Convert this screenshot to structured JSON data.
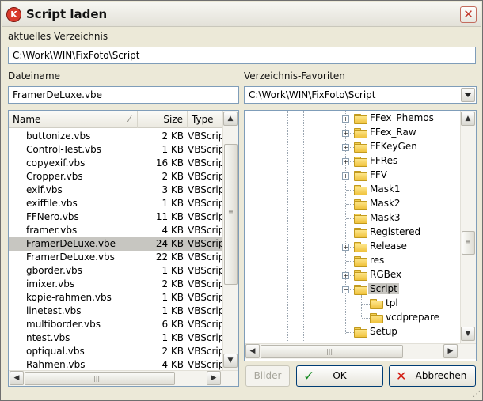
{
  "window": {
    "title": "Script laden",
    "app_icon_letter": "K",
    "close_glyph": "✕"
  },
  "current_dir": {
    "label": "aktuelles Verzeichnis",
    "value": "C:\\Work\\WIN\\FixFoto\\Script"
  },
  "filename": {
    "label": "Dateiname",
    "value": "FramerDeLuxe.vbe"
  },
  "favorites": {
    "label": "Verzeichnis-Favoriten",
    "value": "C:\\Work\\WIN\\FixFoto\\Script"
  },
  "file_list": {
    "columns": [
      "Name",
      "Size",
      "Type"
    ],
    "rows": [
      {
        "name": "buttonize.vbs",
        "size": "2 KB",
        "type": "VBScript"
      },
      {
        "name": "Control-Test.vbs",
        "size": "1 KB",
        "type": "VBScript"
      },
      {
        "name": "copyexif.vbs",
        "size": "16 KB",
        "type": "VBScript"
      },
      {
        "name": "Cropper.vbs",
        "size": "2 KB",
        "type": "VBScript"
      },
      {
        "name": "exif.vbs",
        "size": "3 KB",
        "type": "VBScript"
      },
      {
        "name": "exiffile.vbs",
        "size": "1 KB",
        "type": "VBScript"
      },
      {
        "name": "FFNero.vbs",
        "size": "11 KB",
        "type": "VBScript"
      },
      {
        "name": "framer.vbs",
        "size": "4 KB",
        "type": "VBScript"
      },
      {
        "name": "FramerDeLuxe.vbe",
        "size": "24 KB",
        "type": "VBScript"
      },
      {
        "name": "FramerDeLuxe.vbs",
        "size": "22 KB",
        "type": "VBScript"
      },
      {
        "name": "gborder.vbs",
        "size": "1 KB",
        "type": "VBScript"
      },
      {
        "name": "imixer.vbs",
        "size": "2 KB",
        "type": "VBScript"
      },
      {
        "name": "kopie-rahmen.vbs",
        "size": "1 KB",
        "type": "VBScript"
      },
      {
        "name": "linetest.vbs",
        "size": "1 KB",
        "type": "VBScript"
      },
      {
        "name": "multiborder.vbs",
        "size": "6 KB",
        "type": "VBScript"
      },
      {
        "name": "ntest.vbs",
        "size": "1 KB",
        "type": "VBScript"
      },
      {
        "name": "optiqual.vbs",
        "size": "2 KB",
        "type": "VBScript"
      },
      {
        "name": "Rahmen.vbs",
        "size": "4 KB",
        "type": "VBScript"
      }
    ],
    "selected_index": 8
  },
  "tree": {
    "items": [
      {
        "label": "FFex_Phemos",
        "expander": "+"
      },
      {
        "label": "FFex_Raw",
        "expander": "+"
      },
      {
        "label": "FFKeyGen",
        "expander": "+"
      },
      {
        "label": "FFRes",
        "expander": "+"
      },
      {
        "label": "FFV",
        "expander": "+"
      },
      {
        "label": "Mask1",
        "expander": ""
      },
      {
        "label": "Mask2",
        "expander": ""
      },
      {
        "label": "Mask3",
        "expander": ""
      },
      {
        "label": "Registered",
        "expander": ""
      },
      {
        "label": "Release",
        "expander": "+"
      },
      {
        "label": "res",
        "expander": ""
      },
      {
        "label": "RGBex",
        "expander": "+"
      },
      {
        "label": "Script",
        "expander": "−"
      },
      {
        "label": "tpl",
        "expander": "",
        "child": true
      },
      {
        "label": "vcdprepare",
        "expander": "",
        "child": true
      },
      {
        "label": "Setup",
        "expander": ""
      }
    ],
    "selected_index": 12
  },
  "buttons": {
    "bilder": "Bilder",
    "ok": "OK",
    "cancel": "Abbrechen",
    "check_glyph": "✓",
    "x_glyph": "✕"
  },
  "scroll_glyphs": {
    "up": "▲",
    "down": "▼",
    "left": "◀",
    "right": "▶",
    "grip_v": "≡",
    "grip_h": "|||",
    "resize": "⋰"
  },
  "sort_indicator": "⁄"
}
